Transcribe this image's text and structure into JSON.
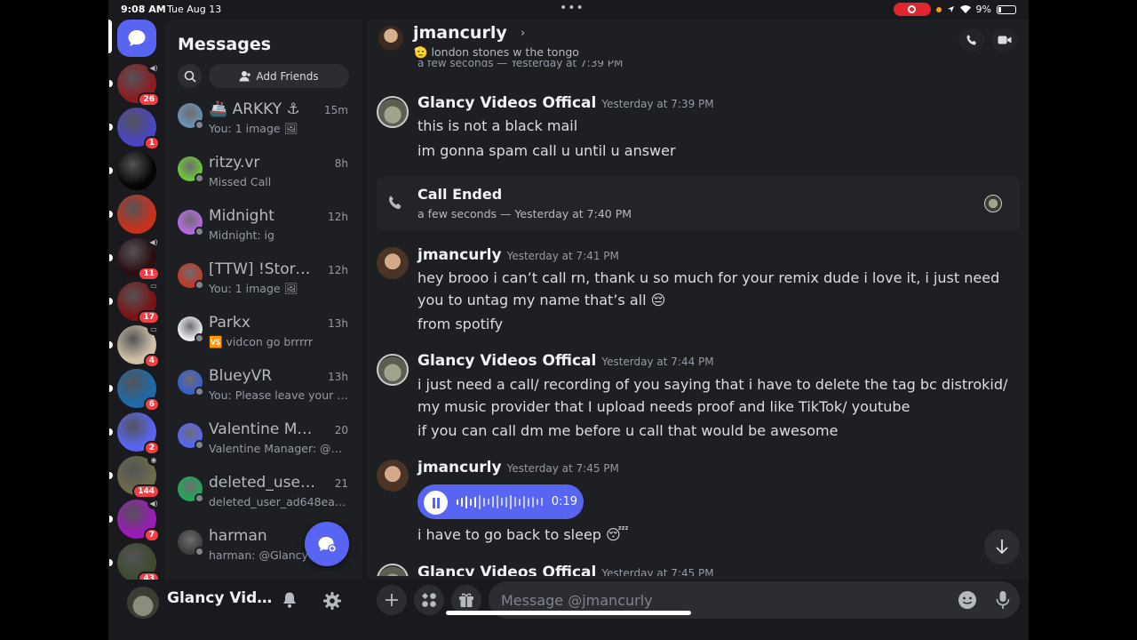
{
  "status_bar": {
    "time": "9:08 AM",
    "date": "Tue Aug 13",
    "battery": "9%"
  },
  "servers": [
    {
      "color": "#8b1d22",
      "badge": "26",
      "icon": "speaker-icon"
    },
    {
      "color": "#4a46c2",
      "badge": "1"
    },
    {
      "color": "#050505",
      "badge": ""
    },
    {
      "color": "#c8321c",
      "badge": ""
    },
    {
      "color": "#2a0d12",
      "badge": "11",
      "icon": "speaker-icon"
    },
    {
      "color": "#7a1414",
      "badge": "17",
      "icon": "screen-icon"
    },
    {
      "color": "#cfc0a8",
      "badge": "4",
      "icon": "screen-icon"
    },
    {
      "color": "#1d6aa8",
      "badge": "6"
    },
    {
      "color": "#5865f2",
      "badge": "2"
    },
    {
      "color": "#6d6a4a",
      "badge": "144",
      "icon": "stage-icon"
    },
    {
      "color": "#9b1bb8",
      "badge": "7",
      "icon": "speaker-icon"
    },
    {
      "color": "#3d4a2e",
      "badge": "43"
    }
  ],
  "dm_panel": {
    "title": "Messages",
    "add_friends": "Add Friends",
    "items": [
      {
        "name": "🚢 ARKKY ⚓",
        "time": "15m",
        "preview": "You: 1 image 🖼",
        "avatar": "#6a8fb0"
      },
      {
        "name": "ritzy.vr",
        "time": "8h",
        "preview": "Missed Call",
        "avatar": "#6cc43a"
      },
      {
        "name": "Midnight",
        "time": "12h",
        "preview": "Midnight: ig",
        "avatar": "#b46ae0"
      },
      {
        "name": "[TTW] !Stormy!",
        "time": "12h",
        "preview": "You: 1 image 🖼",
        "avatar": "#c0392b"
      },
      {
        "name": "Parkx",
        "time": "13h",
        "preview": "🆚 vidcon go brrrrr",
        "avatar": "#e9e9ee"
      },
      {
        "name": "BlueyVR",
        "time": "13h",
        "preview": "You: Please leave your e...",
        "avatar": "#3a5fc8"
      },
      {
        "name": "Valentine Manager",
        "time": "20",
        "preview": "Valentine Manager: @Gl...",
        "avatar": "#5865f2"
      },
      {
        "name": "deleted_user_ad...",
        "time": "21",
        "preview": "deleted_user_ad648ea3...",
        "avatar": "#23a55a"
      },
      {
        "name": "harman",
        "time": "",
        "preview": "harman: @Glancy",
        "avatar": "#3f3f3f"
      }
    ]
  },
  "user_bar": {
    "name": "Glancy Vide..."
  },
  "chat": {
    "recipient": "jmancurly",
    "recipient_status": "🫡 london stones w the tongo",
    "clipped_top": "a few seconds — Yesterday at 7:39 PM",
    "groups": [
      {
        "author": "Glancy Videos Offical",
        "time": "Yesterday at 7:39 PM",
        "lines": [
          "this is not a black mail",
          "im gonna spam call u  until u answer"
        ]
      },
      {
        "author": "jmancurly",
        "time": "Yesterday at 7:41 PM",
        "lines": [
          "hey brooo i can’t call rn, thank u so much for your remix dude i love it, i just need you to untag my name that’s all 😔",
          "from spotify"
        ]
      },
      {
        "author": "Glancy Videos Offical",
        "time": "Yesterday at 7:44 PM",
        "lines": [
          "i just need a call/ recording of you saying that i have to delete the tag bc distrokid/ my music provider that I upload needs proof and like TikTok/ youtube",
          "if you can call dm me before u call that would be awesome"
        ]
      },
      {
        "author": "jmancurly",
        "time": "Yesterday at 7:45 PM",
        "lines": [
          "i have to go back to sleep 😴"
        ]
      }
    ],
    "call_card": {
      "title": "Call Ended",
      "subtitle": "a few seconds — Yesterday at 7:40 PM"
    },
    "voice_message": {
      "duration": "0:19",
      "progress": 0.25
    },
    "clipped_bottom_author": "Glancy Videos Offical",
    "clipped_bottom_time": "Yesterday at 7:45 PM"
  },
  "composer": {
    "placeholder": "Message @jmancurly"
  },
  "colors": {
    "accent": "#5865f2",
    "danger": "#f23f43",
    "bg": "#1e1f22"
  }
}
